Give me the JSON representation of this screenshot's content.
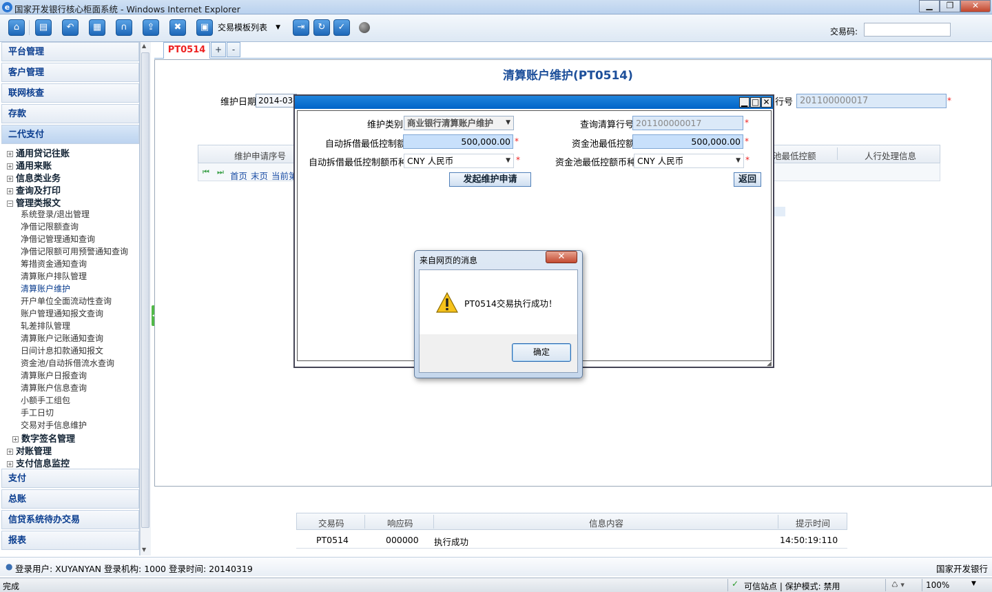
{
  "window": {
    "title": "国家开发银行核心柜面系统 - Windows Internet Explorer",
    "minimize": "▁",
    "restore": "❐",
    "close": "✕"
  },
  "toolbar": {
    "template_select": "交易模板列表",
    "txcode_label": "交易码:",
    "txcode_value": ""
  },
  "sidebar": {
    "sections_top": [
      "平台管理",
      "客户管理",
      "联网核查",
      "存款",
      "二代支付"
    ],
    "tree": [
      {
        "label": "通用贷记往账",
        "expanded": false
      },
      {
        "label": "通用来账",
        "expanded": false
      },
      {
        "label": "信息类业务",
        "expanded": false
      },
      {
        "label": "查询及打印",
        "expanded": false
      },
      {
        "label": "管理类报文",
        "expanded": true
      }
    ],
    "leaves": [
      "系统登录/退出管理",
      "净借记限额查询",
      "净借记管理通知查询",
      "净借记限额可用预警通知查询",
      "筹措资金通知查询",
      "清算账户排队管理",
      "清算账户维护",
      "开户单位全面流动性查询",
      "账户管理通知报文查询",
      "轧差排队管理",
      "清算账户记账通知查询",
      "日间计息扣款通知报文",
      "资金池/自动拆借流水查询",
      "清算账户日报查询",
      "清算账户信息查询",
      "小额手工组包",
      "手工日切",
      "交易对手信息维护"
    ],
    "tree_bottom": [
      {
        "label": "数字签名管理",
        "indent": true
      },
      {
        "label": "对账管理",
        "indent": false
      },
      {
        "label": "支付信息监控",
        "indent": false
      }
    ],
    "sections_bottom": [
      "支付",
      "总账",
      "信贷系统待办交易",
      "报表"
    ],
    "selected_leaf": "清算账户维护"
  },
  "tabs": {
    "active": "PT0514",
    "add": "+",
    "remove": "-"
  },
  "page": {
    "title": "清算账户维护(PT0514)",
    "date_label": "维护日期",
    "date_value": "2014-03-",
    "bank_label": "行号",
    "bank_value": "201100000017",
    "grid_headers": [
      "维护申请序号",
      "池最低控额",
      "人行处理信息"
    ],
    "pager": {
      "first": "首页",
      "last": "末页",
      "current": "当前第"
    }
  },
  "popup": {
    "type_label": "维护类别",
    "type_value": "商业银行清算账户维护",
    "query_bank_label": "查询清算行号",
    "query_bank_value": "201100000017",
    "auto_min_label": "自动拆借最低控制额",
    "auto_min_value": "500,000.00",
    "pool_min_label": "资金池最低控额",
    "pool_min_value": "500,000.00",
    "auto_ccy_label": "自动拆借最低控制额币种",
    "auto_ccy_value": "CNY 人民币",
    "pool_ccy_label": "资金池最低控额币种",
    "pool_ccy_value": "CNY 人民币",
    "submit": "发起维护申请",
    "back": "返回"
  },
  "message": {
    "title": "来自网页的消息",
    "text": "PT0514交易执行成功！",
    "ok": "确定"
  },
  "result": {
    "headers": [
      "交易码",
      "响应码",
      "信息内容",
      "提示时间"
    ],
    "row": {
      "code": "PT0514",
      "resp": "000000",
      "info": "执行成功",
      "time": "14:50:19:110"
    }
  },
  "userbar": {
    "text": "登录用户: XUYANYAN 登录机构: 1000 登录时间: 20140319",
    "bank": "国家开发银行"
  },
  "status": {
    "done": "完成",
    "trusted": "可信站点 | 保护模式: 禁用",
    "zoom": "100%"
  }
}
